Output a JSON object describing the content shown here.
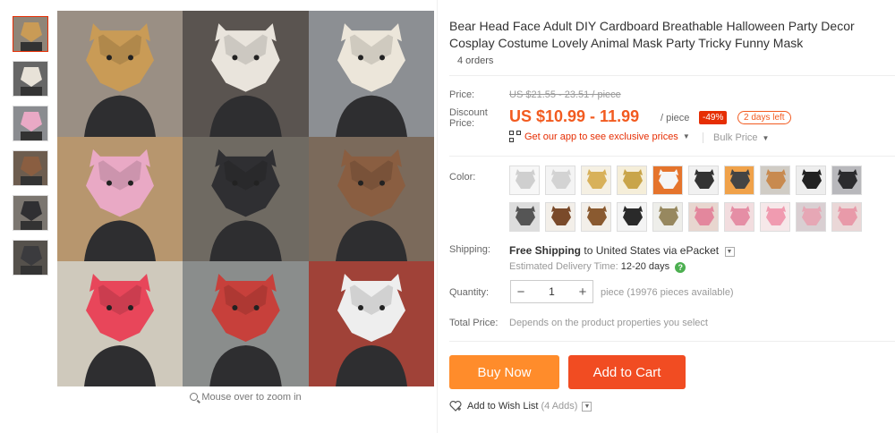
{
  "product": {
    "title": "Bear Head Face Adult DIY Cardboard Breathable Halloween Party Decor Cosplay Costume Lovely Animal Mask Party Tricky Funny Mask",
    "orders": "4 orders"
  },
  "gallery": {
    "zoom_hint": "Mouse over to zoom in",
    "thumb_icons": [
      "monkey-mask-thumb",
      "cat-mask-thumb",
      "mask-collage-thumb",
      "fox-mask-thumb",
      "bear-mask-thumb",
      "dog-mask-thumb"
    ],
    "cells": [
      {
        "bg": "#9a8f84",
        "fg": "#c99b56",
        "icon": "monkey-mask-photo"
      },
      {
        "bg": "#5a5450",
        "fg": "#e9e4dc",
        "icon": "cat-mask-photo"
      },
      {
        "bg": "#8c8f93",
        "fg": "#ece6da",
        "icon": "fox-mask-photo"
      },
      {
        "bg": "#b7966e",
        "fg": "#e9a9c5",
        "icon": "unicorn-mask-photo"
      },
      {
        "bg": "#6f6a62",
        "fg": "#2f2f32",
        "icon": "dog-masks-photo"
      },
      {
        "bg": "#7b6a5b",
        "fg": "#8a5e41",
        "icon": "bear-mask-photo"
      },
      {
        "bg": "#cfc9bc",
        "fg": "#e8465a",
        "icon": "rabbit-masks-photo"
      },
      {
        "bg": "#8a8d8c",
        "fg": "#c7403b",
        "icon": "red-fox-mask-photo"
      },
      {
        "bg": "#a04238",
        "fg": "#eeeeee",
        "icon": "white-unicorn-mask-photo"
      }
    ]
  },
  "price": {
    "label": "Price:",
    "original": "US $21.55 - 23.51 / piece",
    "discount_label": "Discount Price:",
    "discount": "US $10.99 - 11.99",
    "unit": "/ piece",
    "percent_off": "-49%",
    "days_left": "2 days left",
    "app_promo": "Get our app to see exclusive prices",
    "bulk": "Bulk Price"
  },
  "color": {
    "label": "Color:",
    "swatches": [
      {
        "icon": "monkey-paper-swatch",
        "bg": "#f7f7f7",
        "fg": "#cfcfcf"
      },
      {
        "icon": "cat-paper-swatch",
        "bg": "#f4f4f4",
        "fg": "#d3d3d3"
      },
      {
        "icon": "lion-yellow-swatch",
        "bg": "#f5f0e3",
        "fg": "#d8b15a"
      },
      {
        "icon": "monkey-yellow-swatch",
        "bg": "#f5eed9",
        "fg": "#c9a54a"
      },
      {
        "icon": "fox-orange-swatch",
        "bg": "#e5742c",
        "fg": "#f5f5f5"
      },
      {
        "icon": "person-black-swatch",
        "bg": "#f1f1f1",
        "fg": "#333333"
      },
      {
        "icon": "tiger-orange-swatch",
        "bg": "#f0a24a",
        "fg": "#444444"
      },
      {
        "icon": "fox-brown-swatch",
        "bg": "#d0ccc5",
        "fg": "#c88a4f"
      },
      {
        "icon": "zebra-swatch",
        "bg": "#eeeeee",
        "fg": "#222222"
      },
      {
        "icon": "black-cat-swatch",
        "bg": "#b8b8bc",
        "fg": "#2b2b2e"
      },
      {
        "icon": "checkered-swatch",
        "bg": "#dddddd",
        "fg": "#555555"
      },
      {
        "icon": "bear-brown-swatch",
        "bg": "#f3efe9",
        "fg": "#7a4a2a"
      },
      {
        "icon": "bear-light-swatch",
        "bg": "#f3efe9",
        "fg": "#8a5a30"
      },
      {
        "icon": "panda-swatch",
        "bg": "#f4f4f4",
        "fg": "#2a2a2a"
      },
      {
        "icon": "bear-grey-swatch",
        "bg": "#eeeeea",
        "fg": "#97885f"
      },
      {
        "icon": "unicorn-pink-swatch",
        "bg": "#e8d6cf",
        "fg": "#e3879d"
      },
      {
        "icon": "unicorn-rose-swatch",
        "bg": "#f2dddf",
        "fg": "#e58ea5"
      },
      {
        "icon": "unicorn-light-swatch",
        "bg": "#f6e8e9",
        "fg": "#f09bb0"
      },
      {
        "icon": "unicorn-white-swatch",
        "bg": "#d9cfd2",
        "fg": "#e6a7b5"
      },
      {
        "icon": "pig-pink-swatch",
        "bg": "#ead7d7",
        "fg": "#e89aa9"
      }
    ]
  },
  "shipping": {
    "label": "Shipping:",
    "free": "Free Shipping",
    "to": "to",
    "destination": "United States",
    "via": "via ePacket",
    "delivery_label": "Estimated Delivery Time:",
    "delivery_value": "12-20 days"
  },
  "quantity": {
    "label": "Quantity:",
    "value": "1",
    "minus": "−",
    "plus": "+",
    "available": "piece (19976 pieces available)"
  },
  "total": {
    "label": "Total Price:",
    "note": "Depends on the product properties you select"
  },
  "actions": {
    "buy_now": "Buy Now",
    "add_to_cart": "Add to Cart",
    "wishlist": "Add to Wish List",
    "wishlist_count": "(4 Adds)"
  },
  "colors": {
    "accent": "#f25b20",
    "buy_now": "#ff8c2b",
    "add_to_cart": "#f14c22",
    "discount_badge": "#e62e04"
  }
}
